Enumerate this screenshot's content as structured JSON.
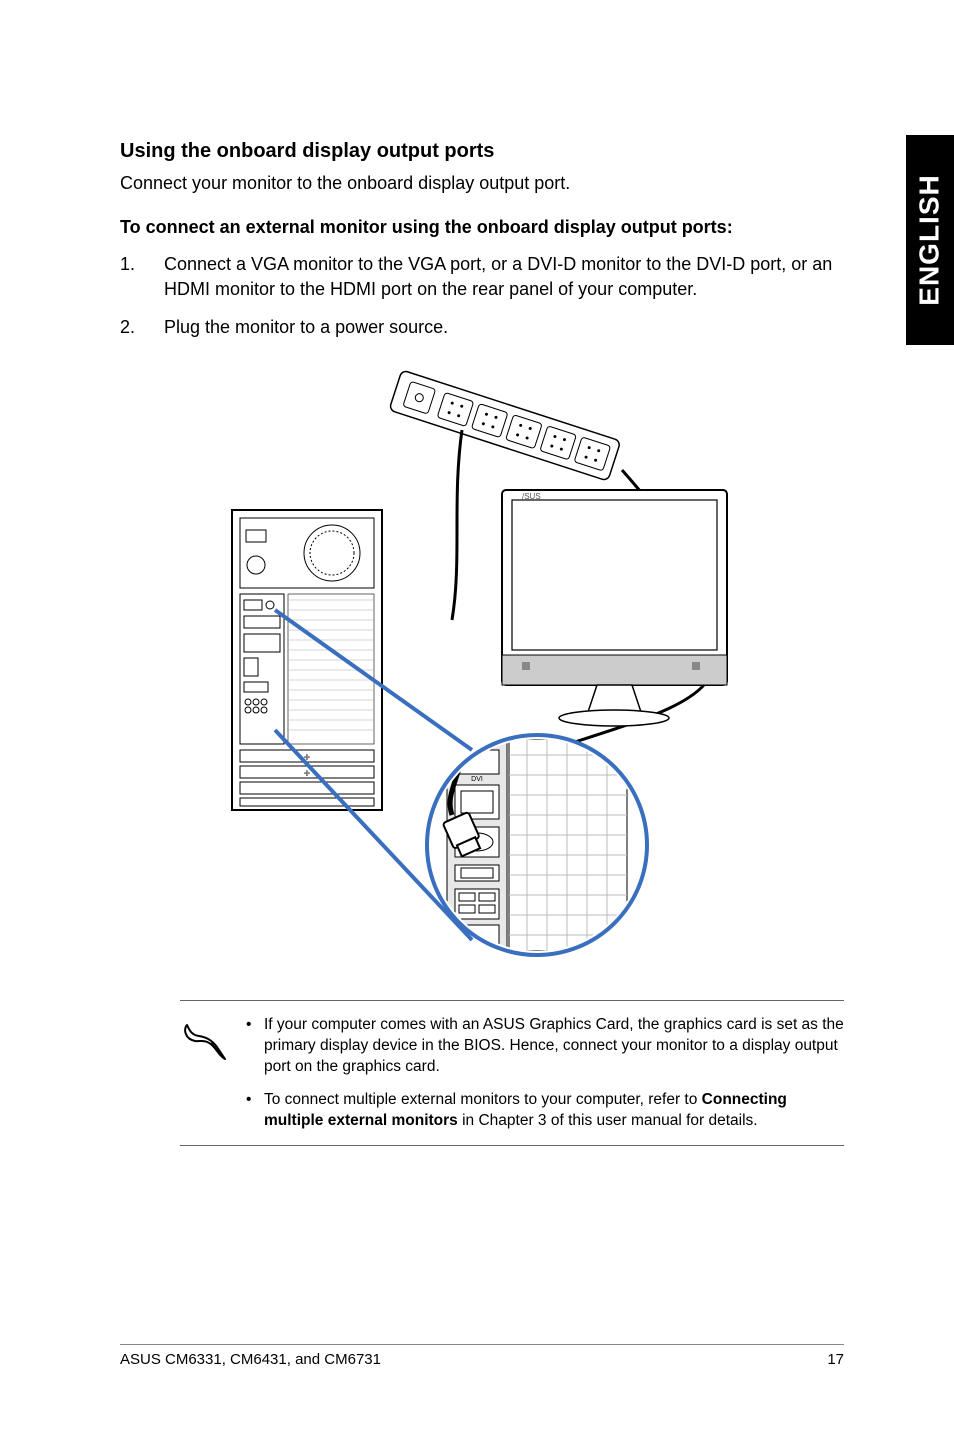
{
  "sideTab": "ENGLISH",
  "section": {
    "title": "Using the onboard display output ports",
    "intro": "Connect your monitor to the onboard display output port.",
    "subhead": "To connect an external monitor using the onboard display output ports:",
    "steps": [
      {
        "num": "1.",
        "text": "Connect a VGA monitor to the VGA port, or a DVI-D monitor to the DVI-D port, or an HDMI monitor to the HDMI port on the rear panel of your computer."
      },
      {
        "num": "2.",
        "text": "Plug the monitor to a power source."
      }
    ]
  },
  "notes": {
    "item1_part1": "If your computer comes with an ASUS Graphics Card, the graphics card is set as the primary display device in the BIOS. Hence, connect your monitor to a display output port on the graphics card.",
    "item2_part1": "To connect multiple external monitors to your computer, refer to ",
    "item2_bold": "Connecting multiple external monitors",
    "item2_part2": " in Chapter 3 of this user manual for details."
  },
  "footer": {
    "left": "ASUS CM6331, CM6431, and CM6731",
    "right": "17"
  }
}
